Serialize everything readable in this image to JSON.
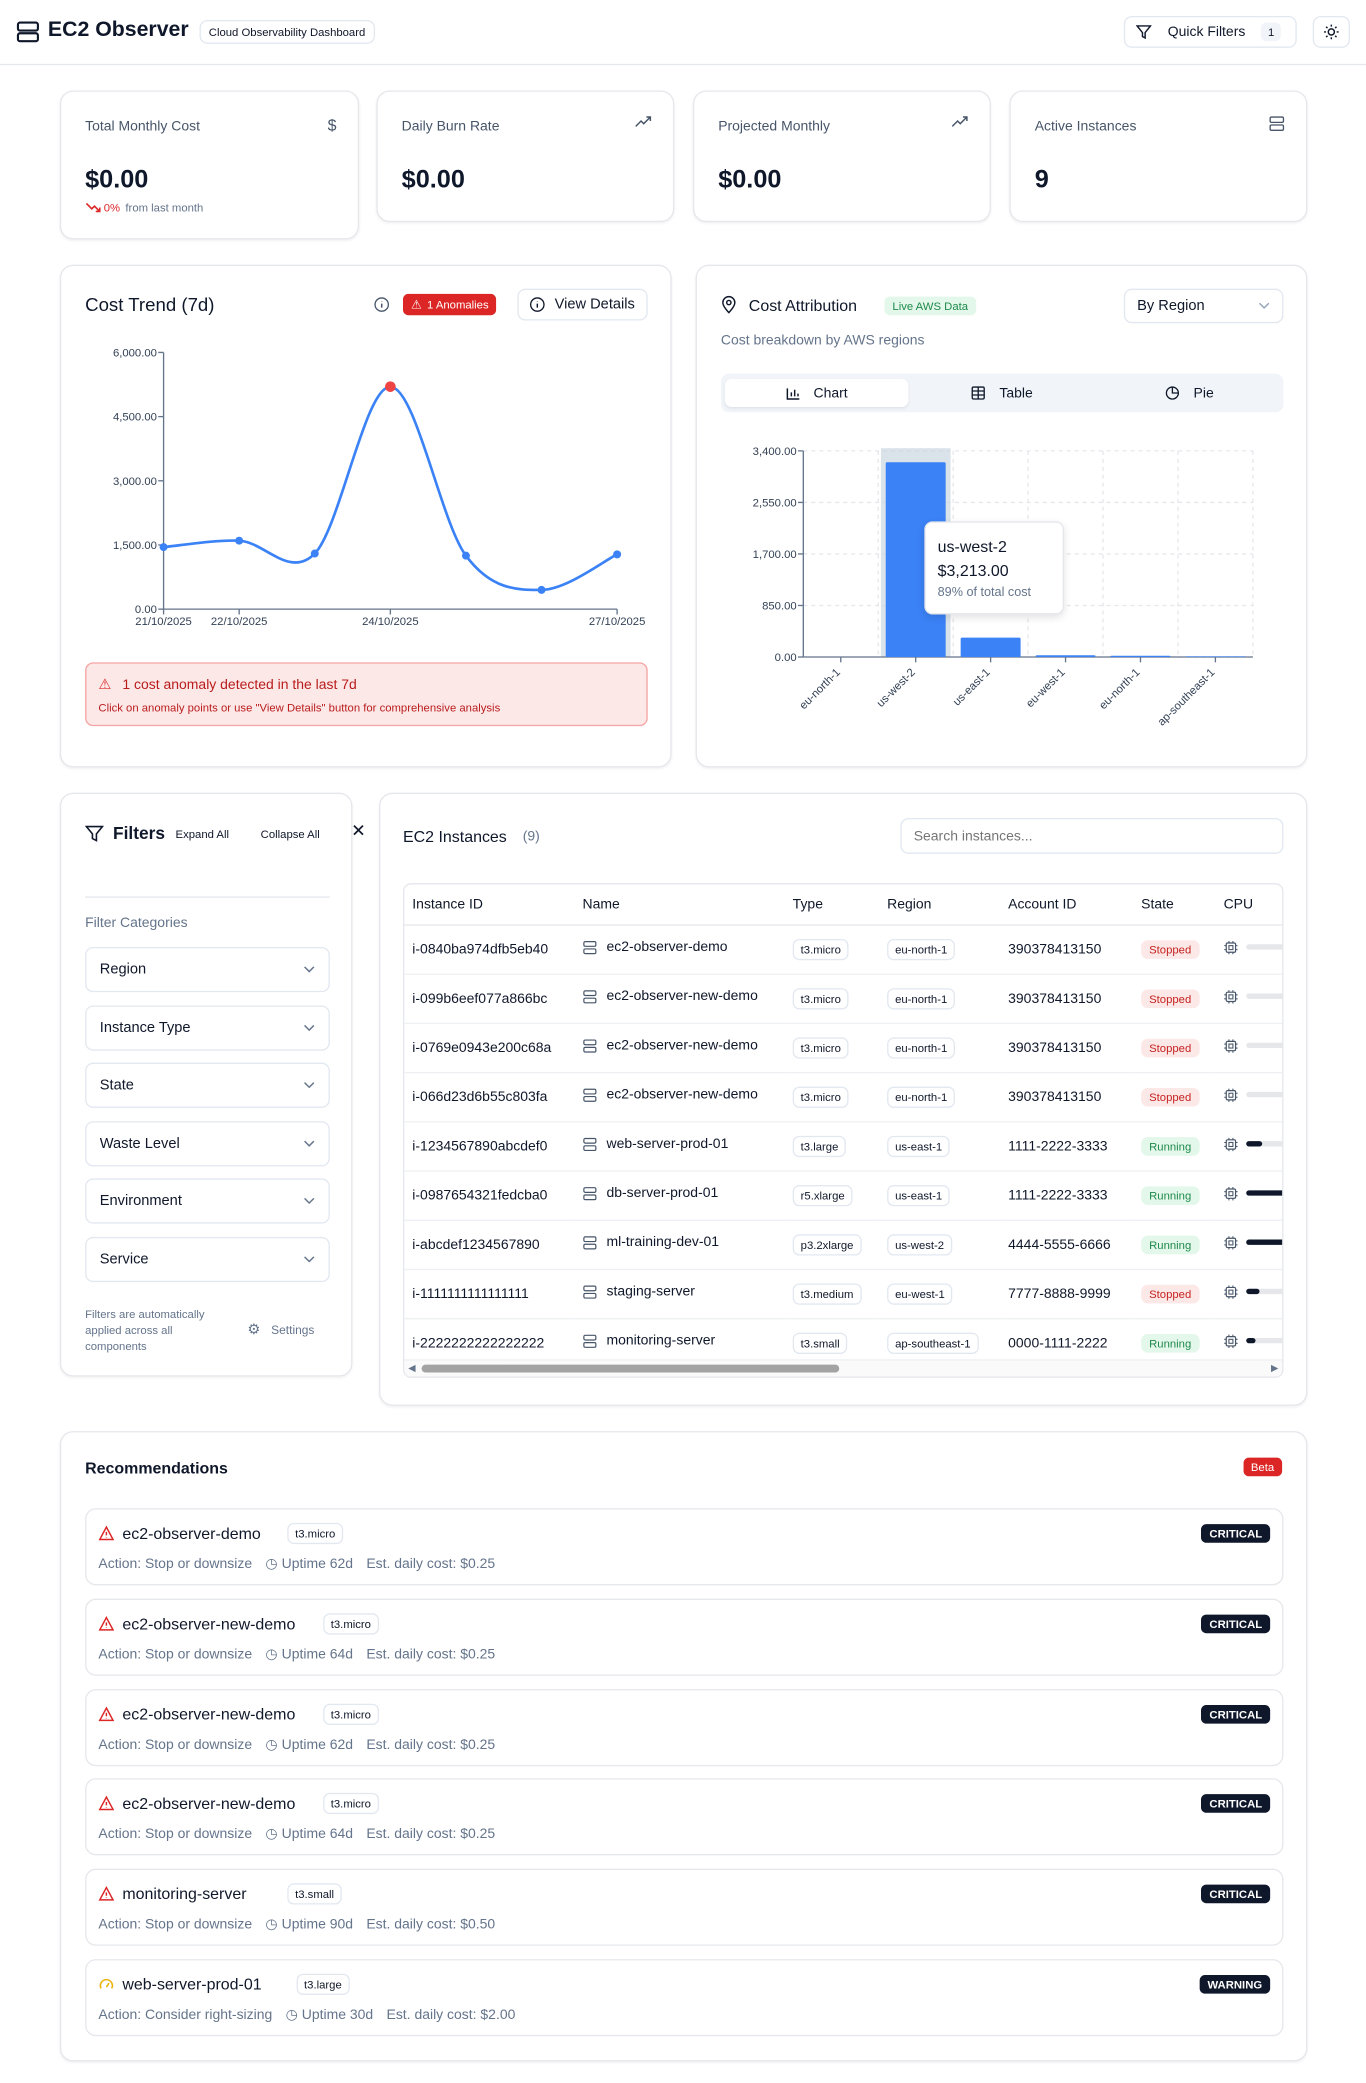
{
  "app": {
    "title": "EC2 Observer",
    "subtitle_badge": "Cloud Observability Dashboard"
  },
  "header": {
    "quick_filters_label": "Quick Filters",
    "quick_filters_count": "1"
  },
  "stats": [
    {
      "label": "Total Monthly Cost",
      "value": "$0.00",
      "icon": "dollar-icon",
      "delta": "0%",
      "delta_text": "from last month"
    },
    {
      "label": "Daily Burn Rate",
      "value": "$0.00",
      "icon": "trending-up-icon"
    },
    {
      "label": "Projected Monthly",
      "value": "$0.00",
      "icon": "trending-up-icon"
    },
    {
      "label": "Active Instances",
      "value": "9",
      "icon": "server-icon"
    }
  ],
  "cost_trend": {
    "title": "Cost Trend (7d)",
    "anomalies_badge": "1 Anomalies",
    "view_details_label": "View Details",
    "alert_title": "1 cost anomaly detected in the last 7d",
    "alert_text": "Click on anomaly points or use \"View Details\" button for comprehensive analysis"
  },
  "cost_attribution": {
    "title": "Cost Attribution",
    "live_badge": "Live AWS Data",
    "subtitle": "Cost breakdown by AWS regions",
    "group_by": "By Region",
    "tabs": [
      "Chart",
      "Table",
      "Pie"
    ],
    "tooltip": {
      "region": "us-west-2",
      "cost": "$3,213.00",
      "share": "89% of total cost"
    }
  },
  "chart_data": [
    {
      "type": "line",
      "x": [
        "21/10/2025",
        "22/10/2025",
        "23/10/2025",
        "24/10/2025",
        "25/10/2025",
        "26/10/2025",
        "27/10/2025"
      ],
      "x_tick_labels": [
        "21/10/2025",
        "22/10/2025",
        "24/10/2025",
        "27/10/2025"
      ],
      "y": [
        1450,
        1600,
        1300,
        5200,
        1250,
        450,
        1280
      ],
      "anomaly_index": 3,
      "y_ticks": [
        "0.00",
        "1,500.00",
        "3,000.00",
        "4,500.00",
        "6,000.00"
      ],
      "ylim": [
        0,
        6000
      ],
      "color": "#3b82f6",
      "anomaly_color": "#ef4444"
    },
    {
      "type": "bar",
      "categories": [
        "eu-north-1",
        "us-west-2",
        "us-east-1",
        "eu-west-1",
        "eu-north-1",
        "ap-southeast-1"
      ],
      "values": [
        0,
        3213,
        320,
        30,
        20,
        10
      ],
      "y_ticks": [
        "0.00",
        "850.00",
        "1,700.00",
        "2,550.00",
        "3,400.00"
      ],
      "ylim": [
        0,
        3400
      ],
      "color": "#3b82f6",
      "highlight_index": 1
    }
  ],
  "filters": {
    "title": "Filters",
    "expand_all": "Expand All",
    "collapse_all": "Collapse All",
    "categories_label": "Filter Categories",
    "categories": [
      "Region",
      "Instance Type",
      "State",
      "Waste Level",
      "Environment",
      "Service"
    ],
    "footer_text": "Filters are automatically applied across all components",
    "settings_label": "Settings"
  },
  "instances": {
    "title": "EC2 Instances",
    "count": "(9)",
    "search_placeholder": "Search instances...",
    "columns": [
      "Instance ID",
      "Name",
      "Type",
      "Region",
      "Account ID",
      "State",
      "CPU"
    ],
    "rows": [
      {
        "id": "i-0840ba974dfb5eb40",
        "name": "ec2-observer-demo",
        "type": "t3.micro",
        "region": "eu-north-1",
        "account": "390378413150",
        "state": "Stopped",
        "cpu": 0.0
      },
      {
        "id": "i-099b6eef077a866bc",
        "name": "ec2-observer-new-demo",
        "type": "t3.micro",
        "region": "eu-north-1",
        "account": "390378413150",
        "state": "Stopped",
        "cpu": 0.0
      },
      {
        "id": "i-0769e0943e200c68a",
        "name": "ec2-observer-new-demo",
        "type": "t3.micro",
        "region": "eu-north-1",
        "account": "390378413150",
        "state": "Stopped",
        "cpu": 0.0
      },
      {
        "id": "i-066d23d6b55c803fa",
        "name": "ec2-observer-new-demo",
        "type": "t3.micro",
        "region": "eu-north-1",
        "account": "390378413150",
        "state": "Stopped",
        "cpu": 0.0
      },
      {
        "id": "i-1234567890abcdef0",
        "name": "web-server-prod-01",
        "type": "t3.large",
        "region": "us-east-1",
        "account": "1111-2222-3333",
        "state": "Running",
        "cpu": 0.35
      },
      {
        "id": "i-0987654321fedcba0",
        "name": "db-server-prod-01",
        "type": "r5.xlarge",
        "region": "us-east-1",
        "account": "1111-2222-3333",
        "state": "Running",
        "cpu": 0.95
      },
      {
        "id": "i-abcdef1234567890",
        "name": "ml-training-dev-01",
        "type": "p3.2xlarge",
        "region": "us-west-2",
        "account": "4444-5555-6666",
        "state": "Running",
        "cpu": 0.95
      },
      {
        "id": "i-1111111111111111",
        "name": "staging-server",
        "type": "t3.medium",
        "region": "eu-west-1",
        "account": "7777-8888-9999",
        "state": "Stopped",
        "cpu": 0.3
      },
      {
        "id": "i-2222222222222222",
        "name": "monitoring-server",
        "type": "t3.small",
        "region": "ap-southeast-1",
        "account": "0000-1111-2222",
        "state": "Running",
        "cpu": 0.2
      }
    ]
  },
  "recommendations": {
    "title": "Recommendations",
    "beta_badge": "Beta",
    "items": [
      {
        "name": "ec2-observer-demo",
        "type": "t3.micro",
        "action": "Action: Stop or downsize",
        "uptime": "Uptime 62d",
        "cost": "Est. daily cost: $0.25",
        "severity": "CRITICAL"
      },
      {
        "name": "ec2-observer-new-demo",
        "type": "t3.micro",
        "action": "Action: Stop or downsize",
        "uptime": "Uptime 64d",
        "cost": "Est. daily cost: $0.25",
        "severity": "CRITICAL"
      },
      {
        "name": "ec2-observer-new-demo",
        "type": "t3.micro",
        "action": "Action: Stop or downsize",
        "uptime": "Uptime 62d",
        "cost": "Est. daily cost: $0.25",
        "severity": "CRITICAL"
      },
      {
        "name": "ec2-observer-new-demo",
        "type": "t3.micro",
        "action": "Action: Stop or downsize",
        "uptime": "Uptime 64d",
        "cost": "Est. daily cost: $0.25",
        "severity": "CRITICAL"
      },
      {
        "name": "monitoring-server",
        "type": "t3.small",
        "action": "Action: Stop or downsize",
        "uptime": "Uptime 90d",
        "cost": "Est. daily cost: $0.50",
        "severity": "CRITICAL"
      },
      {
        "name": "web-server-prod-01",
        "type": "t3.large",
        "action": "Action: Consider right-sizing",
        "uptime": "Uptime 30d",
        "cost": "Est. daily cost: $2.00",
        "severity": "WARNING"
      }
    ]
  }
}
